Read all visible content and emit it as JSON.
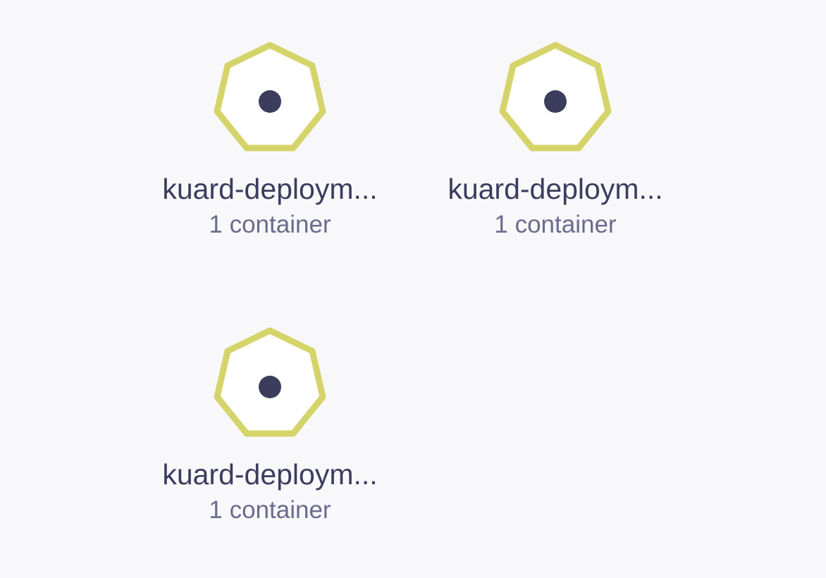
{
  "colors": {
    "background": "#f8f8fa",
    "pod_outline": "#d5d46a",
    "pod_fill": "#ffffff",
    "pod_dot": "#3c3c5c",
    "name_text": "#3b3d5e",
    "sub_text": "#6b6b8e"
  },
  "pods": [
    {
      "icon": "pod-heptagon-icon",
      "name": "kuard-deploym...",
      "containers": "1 container"
    },
    {
      "icon": "pod-heptagon-icon",
      "name": "kuard-deploym...",
      "containers": "1 container"
    },
    {
      "icon": "pod-heptagon-icon",
      "name": "kuard-deploym...",
      "containers": "1 container"
    }
  ]
}
